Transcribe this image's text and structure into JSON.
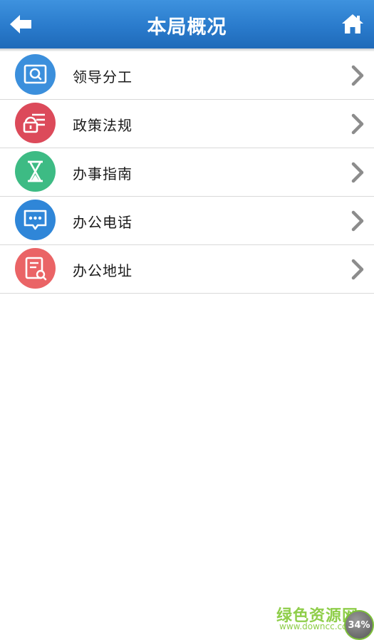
{
  "header": {
    "title": "本局概况",
    "back_icon": "back-arrow-icon",
    "home_icon": "home-icon",
    "colors": {
      "bar": "#2a7bcc"
    }
  },
  "menu": {
    "items": [
      {
        "label": "领导分工",
        "icon": "search-document-icon",
        "color": "#3b8fdc"
      },
      {
        "label": "政策法规",
        "icon": "lock-list-icon",
        "color": "#dc4a5a"
      },
      {
        "label": "办事指南",
        "icon": "hourglass-icon",
        "color": "#3dbb84"
      },
      {
        "label": "办公电话",
        "icon": "chat-bubble-icon",
        "color": "#2f86d8"
      },
      {
        "label": "办公地址",
        "icon": "document-search-icon",
        "color": "#ea6466"
      }
    ],
    "chevron_icon": "chevron-right-icon"
  },
  "watermark": {
    "site_name": "绿色资源网",
    "url": "www.downcc.com"
  },
  "progress_badge": {
    "value": "34%"
  }
}
